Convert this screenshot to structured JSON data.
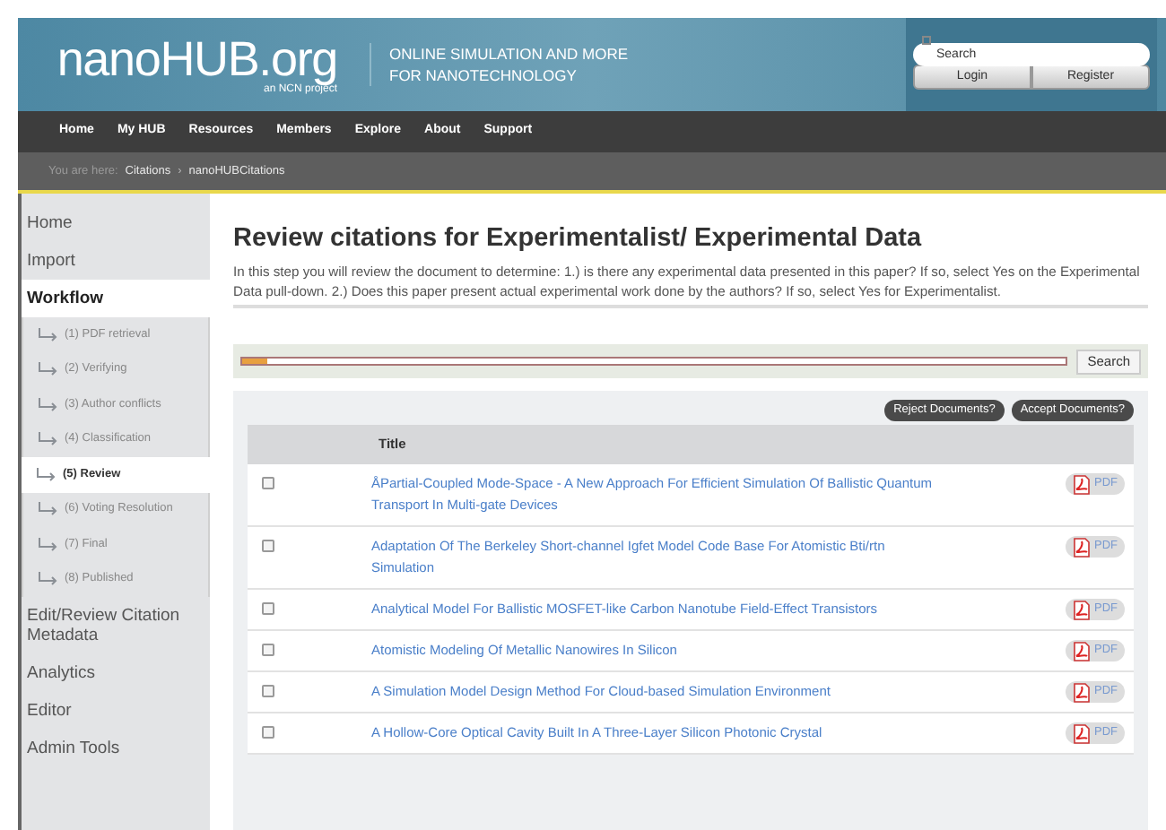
{
  "header": {
    "logo": "nanoHUB.org",
    "logo_sub": "an NCN project",
    "tagline_lines": [
      "ONLINE SIMULATION AND MORE",
      "FOR NANOTECHNOLOGY"
    ],
    "search": {
      "placeholder": "Search"
    },
    "buttons": [
      "Login",
      "Register"
    ]
  },
  "nav": [
    "Home",
    "My HUB",
    "Resources",
    "Members",
    "Explore",
    "About",
    "Support"
  ],
  "breadcrumb": {
    "label": "You are here:",
    "items": [
      "Citations",
      "nanoHUBCitations"
    ],
    "separator": "›"
  },
  "sidebar": [
    {
      "label": "Home",
      "selected": false
    },
    {
      "label": "Import",
      "selected": false
    },
    {
      "label": "Workflow",
      "selected": true,
      "children": [
        {
          "label": "(1) PDF retrieval",
          "selected": false
        },
        {
          "label": "(2) Verifying",
          "selected": false
        },
        {
          "label": "(3) Author conflicts",
          "selected": false
        },
        {
          "label": "(4) Classification",
          "selected": false
        },
        {
          "label": "(5) Review",
          "selected": true
        },
        {
          "label": "(6) Voting Resolution",
          "selected": false
        },
        {
          "label": "(7) Final",
          "selected": false
        },
        {
          "label": "(8) Published",
          "selected": false
        }
      ]
    },
    {
      "label": "Edit/Review Citation Metadata",
      "selected": false
    },
    {
      "label": "Analytics",
      "selected": false
    },
    {
      "label": "Editor",
      "selected": false
    },
    {
      "label": "Admin Tools",
      "selected": false
    }
  ],
  "main": {
    "title": "Review citations for Experimentalist/ Experimental Data",
    "description": "In this step you will review the document to determine: 1.) is there any experimental data presented in this paper? If so, select Yes on the Experimental Data pull-down. 2.) Does this paper present actual experimental work done by the authors? If so, select Yes for Experimentalist.",
    "search_bar": {
      "level": 0.03,
      "button": "Search"
    },
    "actions": [
      "Reject Documents?",
      "Accept Documents?"
    ],
    "table": {
      "columns": [
        "Title"
      ],
      "rows": [
        {
          "checked": false,
          "title": "ÅPartial-Coupled Mode-Space - A New Approach For Efficient Simulation Of Ballistic Quantum Transport In Multi-gate Devices",
          "pdf": "PDF"
        },
        {
          "checked": false,
          "title": "Adaptation Of The Berkeley Short-channel Igfet Model Code Base For Atomistic Bti/rtn Simulation",
          "pdf": "PDF"
        },
        {
          "checked": false,
          "title": "Analytical Model For Ballistic MOSFET-like Carbon Nanotube Field-Effect Transistors",
          "pdf": "PDF"
        },
        {
          "checked": false,
          "title": "Atomistic Modeling Of Metallic Nanowires In Silicon",
          "pdf": "PDF"
        },
        {
          "checked": false,
          "title": "A Simulation Model Design Method For Cloud-based Simulation Environment",
          "pdf": "PDF"
        },
        {
          "checked": false,
          "title": "A Hollow-Core Optical Cavity Built In A Three-Layer Silicon Photonic Crystal",
          "pdf": "PDF"
        }
      ]
    }
  }
}
